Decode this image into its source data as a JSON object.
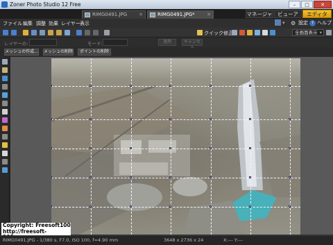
{
  "window": {
    "title": "Zoner Photo Studio 12 Free"
  },
  "tabs": [
    {
      "label": "RIMG0491.JPG"
    },
    {
      "label": "RIMG0491.JPG*"
    }
  ],
  "modes": {
    "manager": "マネージャ",
    "viewer": "ビューア",
    "editor": "エディタ"
  },
  "menu": {
    "items": [
      "ファイル",
      "編集",
      "調整",
      "効果",
      "レイヤー",
      "表示"
    ],
    "settings": "設定",
    "help": "ヘルプ"
  },
  "toolbar": {
    "quick_fix": "クイック修正",
    "zoom_select": "全画面表示"
  },
  "propbar": {
    "layer_label": "レイヤーの:",
    "mode_label": "モード:",
    "apply_label": "適用",
    "cancel_label": "キャンセル"
  },
  "actions": {
    "create_mesh": "メッシュの作成...",
    "delete_mesh": "メッシュの削除",
    "delete_point": "ポイントの削除"
  },
  "watermark": {
    "line1": "Copyright: Freesoft100",
    "line2": "http://freesoft-100.com"
  },
  "status": {
    "info": "RIMG0491.JPG - 1/380 s, F7.0, ISO 100, f=4.90 mm",
    "dimensions": "3648 x 2736 x 24",
    "coords": "X:--- Y:---"
  },
  "colors": {
    "editor_tab_active": "#e8b020",
    "grid_line": "#f4f4ff",
    "workspace_bg": "#595959"
  }
}
